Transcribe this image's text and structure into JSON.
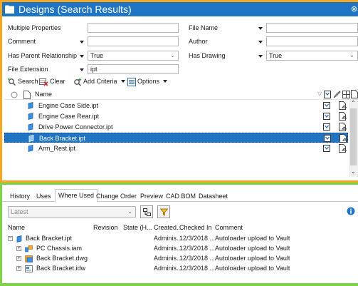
{
  "window": {
    "title": "Designs  (Search Results)",
    "close_glyph": "⊗"
  },
  "criteria": {
    "multiple_properties": {
      "label": "Multiple Properties",
      "value": ""
    },
    "file_name": {
      "label": "File Name",
      "value": ""
    },
    "comment": {
      "label": "Comment",
      "value": ""
    },
    "author": {
      "label": "Author",
      "value": ""
    },
    "has_parent_relationship": {
      "label": "Has Parent Relationship",
      "value": "True"
    },
    "has_drawing": {
      "label": "Has Drawing",
      "value": "True"
    },
    "file_extension": {
      "label": "File Extension",
      "value": "ipt"
    }
  },
  "toolbar": {
    "search": "Search",
    "clear": "Clear",
    "add_criteria": "Add Criteria",
    "options": "Options"
  },
  "results": {
    "column_name": "Name",
    "rows": [
      {
        "name": "Engine Case Side.ipt"
      },
      {
        "name": "Engine Case Rear.ipt"
      },
      {
        "name": "Drive Power Connector.ipt"
      },
      {
        "name": "Back Bracket.ipt",
        "selected": true
      },
      {
        "name": "Arm_Rest.ipt"
      }
    ]
  },
  "tabs": [
    "History",
    "Uses",
    "Where Used",
    "Change Order",
    "Preview",
    "CAD BOM",
    "Datasheet"
  ],
  "active_tab": "Where Used",
  "where_used": {
    "version_select": "Latest",
    "columns": [
      "Name",
      "Revision",
      "State (H...",
      "Created...",
      "Checked In",
      "Comment"
    ],
    "rows": [
      {
        "name": "Back Bracket.ipt",
        "revision": "",
        "state": "",
        "created": "Adminis...",
        "checked_in": "12/3/2018 ...",
        "comment": "Autoloader upload to Vault",
        "level": 0,
        "expander": "−"
      },
      {
        "name": "PC Chassis.iam",
        "revision": "",
        "state": "",
        "created": "Adminis...",
        "checked_in": "12/3/2018 ...",
        "comment": "Autoloader upload to Vault",
        "level": 1,
        "expander": "+"
      },
      {
        "name": "Back Bracket.dwg",
        "revision": "",
        "state": "",
        "created": "Adminis...",
        "checked_in": "12/3/2018 ...",
        "comment": "Autoloader upload to Vault",
        "level": 1,
        "expander": "+"
      },
      {
        "name": "Back Bracket.idw",
        "revision": "",
        "state": "",
        "created": "Adminis...",
        "checked_in": "12/3/2018 ...",
        "comment": "Autoloader upload to Vault",
        "level": 1,
        "expander": "+"
      }
    ]
  },
  "colors": {
    "title_bar": "#1f74c3",
    "selection": "#1f74c3",
    "top_frame": "#f5a623",
    "bottom_frame": "#7fd146",
    "info_icon": "#1f74c3"
  }
}
